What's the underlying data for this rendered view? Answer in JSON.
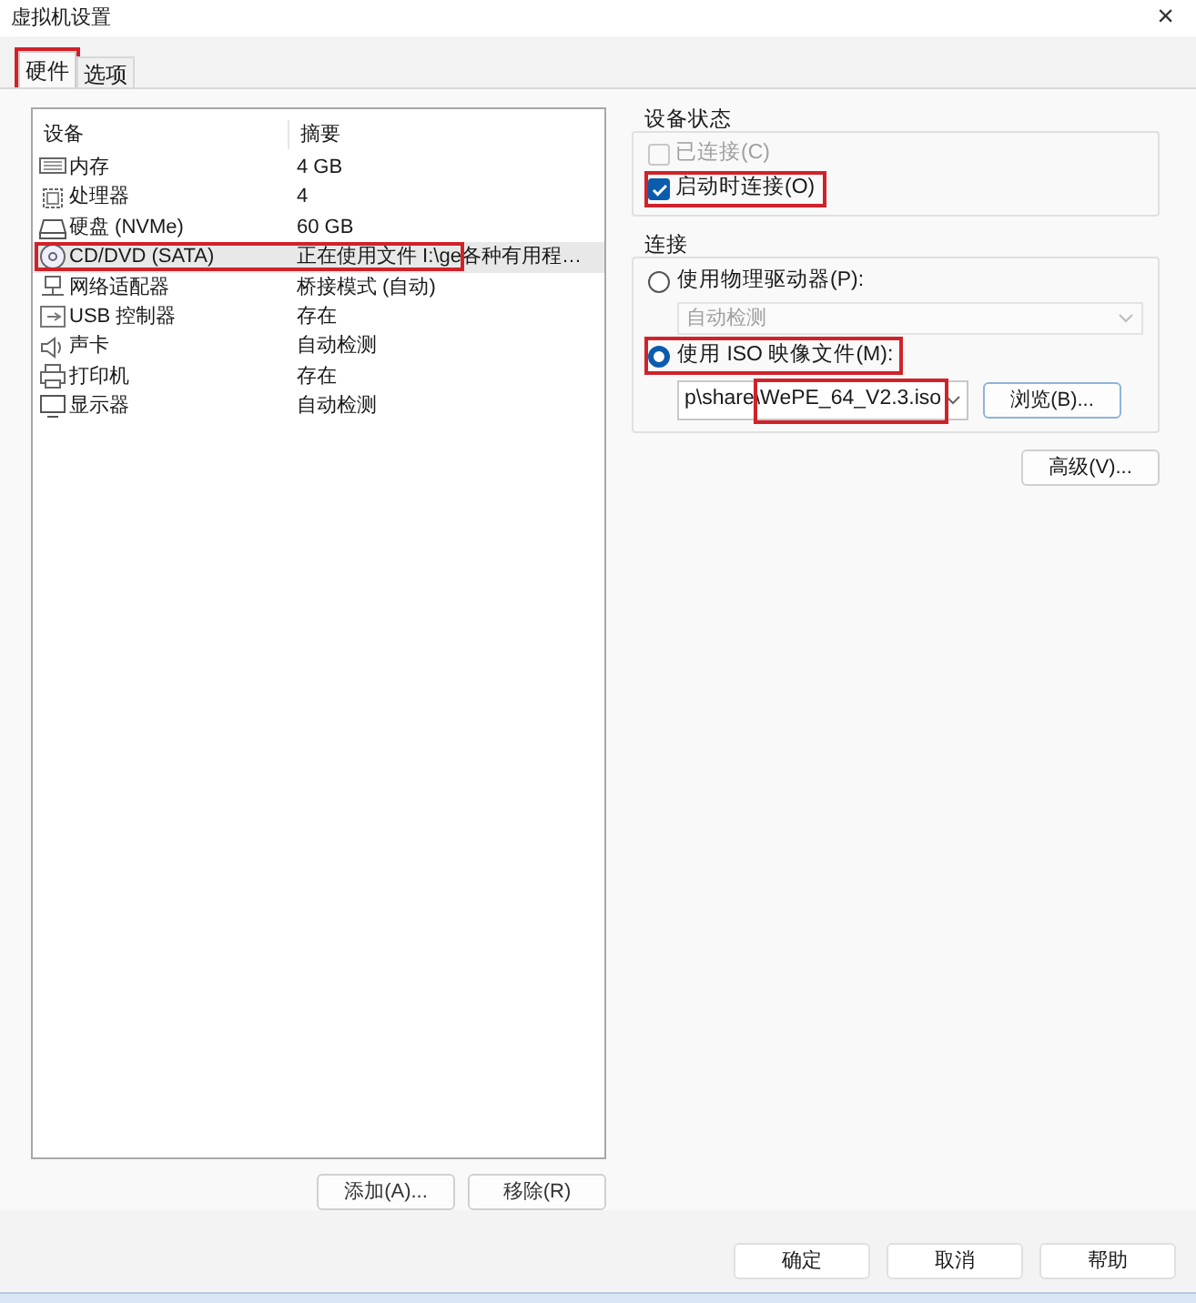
{
  "window": {
    "title": "虚拟机设置",
    "close": "×"
  },
  "tabs": [
    {
      "label": "硬件",
      "selected": true,
      "highlighted": true
    },
    {
      "label": "选项",
      "selected": false,
      "highlighted": false
    }
  ],
  "devices": {
    "columns": [
      "设备",
      "摘要"
    ],
    "rows": [
      {
        "name": "内存",
        "summary": "4 GB",
        "selected": false,
        "highlighted": false
      },
      {
        "name": "处理器",
        "summary": "4",
        "selected": false,
        "highlighted": false
      },
      {
        "name": "硬盘 (NVMe)",
        "summary": "60 GB",
        "selected": false,
        "highlighted": false
      },
      {
        "name": "CD/DVD (SATA)",
        "summary": "正在使用文件 I:\\ge各种有用程…",
        "selected": true,
        "highlighted": true
      },
      {
        "name": "网络适配器",
        "summary": "桥接模式 (自动)",
        "selected": false,
        "highlighted": false
      },
      {
        "name": "USB 控制器",
        "summary": "存在",
        "selected": false,
        "highlighted": false
      },
      {
        "name": "声卡",
        "summary": "自动检测",
        "selected": false,
        "highlighted": false
      },
      {
        "name": "打印机",
        "summary": "存在",
        "selected": false,
        "highlighted": false
      },
      {
        "name": "显示器",
        "summary": "自动检测",
        "selected": false,
        "highlighted": false
      }
    ],
    "buttons": [
      "添加(A)...",
      "移除(R)"
    ]
  },
  "device_status": {
    "title": "设备状态",
    "checkboxes": [
      {
        "label": "已连接(C)",
        "checked": false,
        "disabled": true,
        "highlighted": false
      },
      {
        "label": "启动时连接(O)",
        "checked": true,
        "disabled": false,
        "highlighted": true
      }
    ]
  },
  "connection": {
    "title": "连接",
    "physical": {
      "label": "使用物理驱动器(P):",
      "selected": false,
      "highlighted": false,
      "dropdown": {
        "value": "自动检测",
        "disabled": true
      }
    },
    "iso": {
      "label": "使用 ISO 映像文件(M):",
      "selected": true,
      "highlighted": true,
      "path": "p\\share\\WePE_64_V2.3.iso",
      "path_highlighted": true,
      "browse": "浏览(B)..."
    }
  },
  "advanced": "高级(V)...",
  "footer_buttons": [
    "确定",
    "取消",
    "帮助"
  ]
}
